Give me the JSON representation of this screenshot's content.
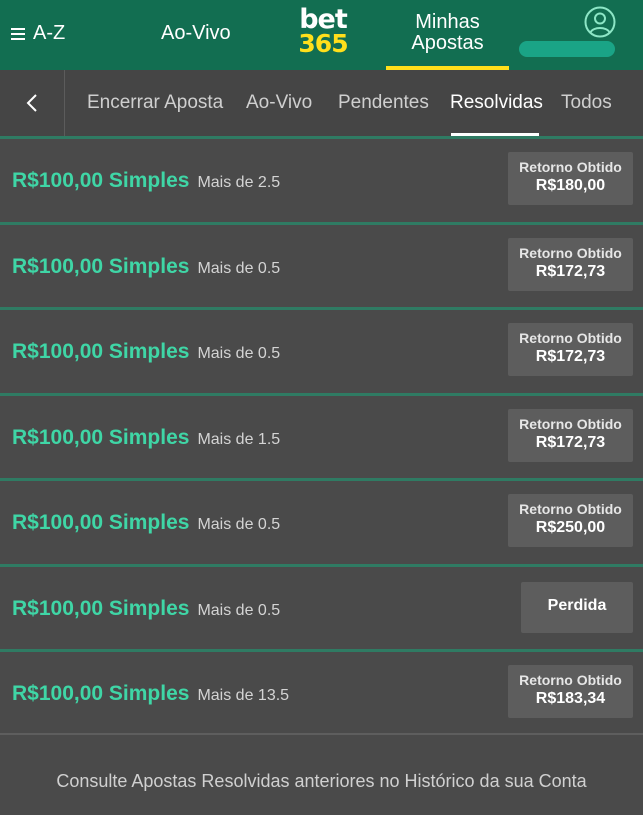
{
  "header": {
    "az_label": "A-Z",
    "aovivo_label": "Ao-Vivo",
    "logo_top": "bet",
    "logo_bottom": "365",
    "minhas_line1": "Minhas",
    "minhas_line2": "Apostas",
    "brand_green": "#126e51",
    "brand_yellow": "#ffdf1b"
  },
  "tabs": [
    {
      "label": "Encerrar Aposta"
    },
    {
      "label": "Ao-Vivo"
    },
    {
      "label": "Pendentes"
    },
    {
      "label": "Resolvidas",
      "active": true
    },
    {
      "label": "Todos"
    }
  ],
  "bets": [
    {
      "stake": "R$100,00 Simples",
      "selection": "Mais de 2.5",
      "result_label": "Retorno Obtido",
      "result_value": "R$180,00"
    },
    {
      "stake": "R$100,00 Simples",
      "selection": "Mais de 0.5",
      "result_label": "Retorno Obtido",
      "result_value": "R$172,73"
    },
    {
      "stake": "R$100,00 Simples",
      "selection": "Mais de 0.5",
      "result_label": "Retorno Obtido",
      "result_value": "R$172,73"
    },
    {
      "stake": "R$100,00 Simples",
      "selection": "Mais de 1.5",
      "result_label": "Retorno Obtido",
      "result_value": "R$172,73"
    },
    {
      "stake": "R$100,00 Simples",
      "selection": "Mais de 0.5",
      "result_label": "Retorno Obtido",
      "result_value": "R$250,00"
    },
    {
      "stake": "R$100,00 Simples",
      "selection": "Mais de 0.5",
      "result_label": "Perdida",
      "result_value": ""
    },
    {
      "stake": "R$100,00 Simples",
      "selection": "Mais de 13.5",
      "result_label": "Retorno Obtido",
      "result_value": "R$183,34"
    }
  ],
  "footer": {
    "text": "Consulte Apostas Resolvidas anteriores no Histórico da sua Conta"
  },
  "colors": {
    "stake_green": "#3fd6a6",
    "row_separator": "#2f7b63",
    "background": "#4a4a4a"
  },
  "icons": {
    "menu": "hamburger-icon",
    "user": "user-icon",
    "back": "chevron-left-icon"
  }
}
